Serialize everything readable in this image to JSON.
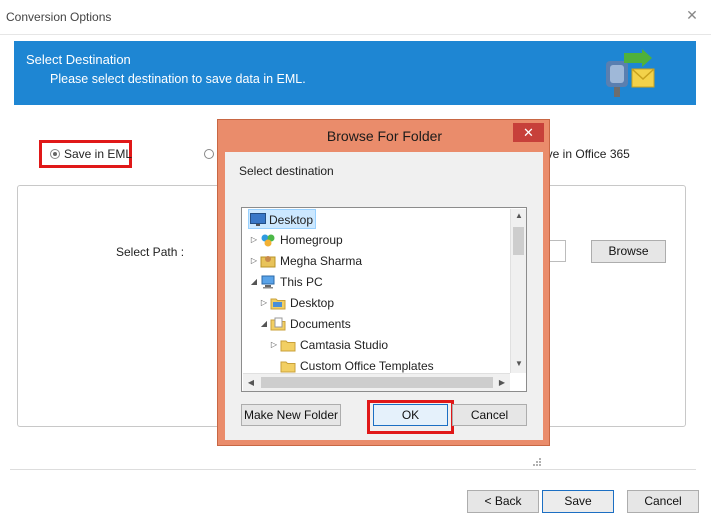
{
  "window": {
    "title": "Conversion Options",
    "close_glyph": "✕"
  },
  "header": {
    "heading": "Select Destination",
    "subtext": "Please select destination to save data in EML.",
    "logo_icon": "mailbox-conversion-icon"
  },
  "options": {
    "save_eml": "Save in EML",
    "save_office365": "ave in Office 365"
  },
  "path": {
    "label": "Select Path :",
    "browse": "Browse"
  },
  "footer": {
    "back": "< Back",
    "save": "Save",
    "cancel": "Cancel"
  },
  "dialog": {
    "title": "Browse For Folder",
    "close_glyph": "✕",
    "instruction": "Select destination",
    "tree": [
      {
        "label": "Desktop",
        "icon": "desktop-icon",
        "expand": "",
        "selected": true
      },
      {
        "label": "Homegroup",
        "icon": "homegroup-icon",
        "expand": "▷",
        "selected": false
      },
      {
        "label": "Megha Sharma",
        "icon": "user-folder-icon",
        "expand": "▷",
        "selected": false
      },
      {
        "label": "This PC",
        "icon": "computer-icon",
        "expand": "◢",
        "selected": false
      },
      {
        "label": "Desktop",
        "icon": "folder-icon",
        "expand": "▷",
        "selected": false
      },
      {
        "label": "Documents",
        "icon": "documents-folder-icon",
        "expand": "◢",
        "selected": false
      },
      {
        "label": "Camtasia Studio",
        "icon": "folder-icon",
        "expand": "▷",
        "selected": false
      },
      {
        "label": "Custom Office Templates",
        "icon": "folder-icon",
        "expand": "",
        "selected": false
      }
    ],
    "new_folder": "Make New Folder",
    "ok": "OK",
    "cancel": "Cancel"
  },
  "colors": {
    "banner": "#1e86d3",
    "dialog_frame": "#ea8c6b",
    "highlight": "#e01818",
    "close_red": "#c7403a"
  }
}
